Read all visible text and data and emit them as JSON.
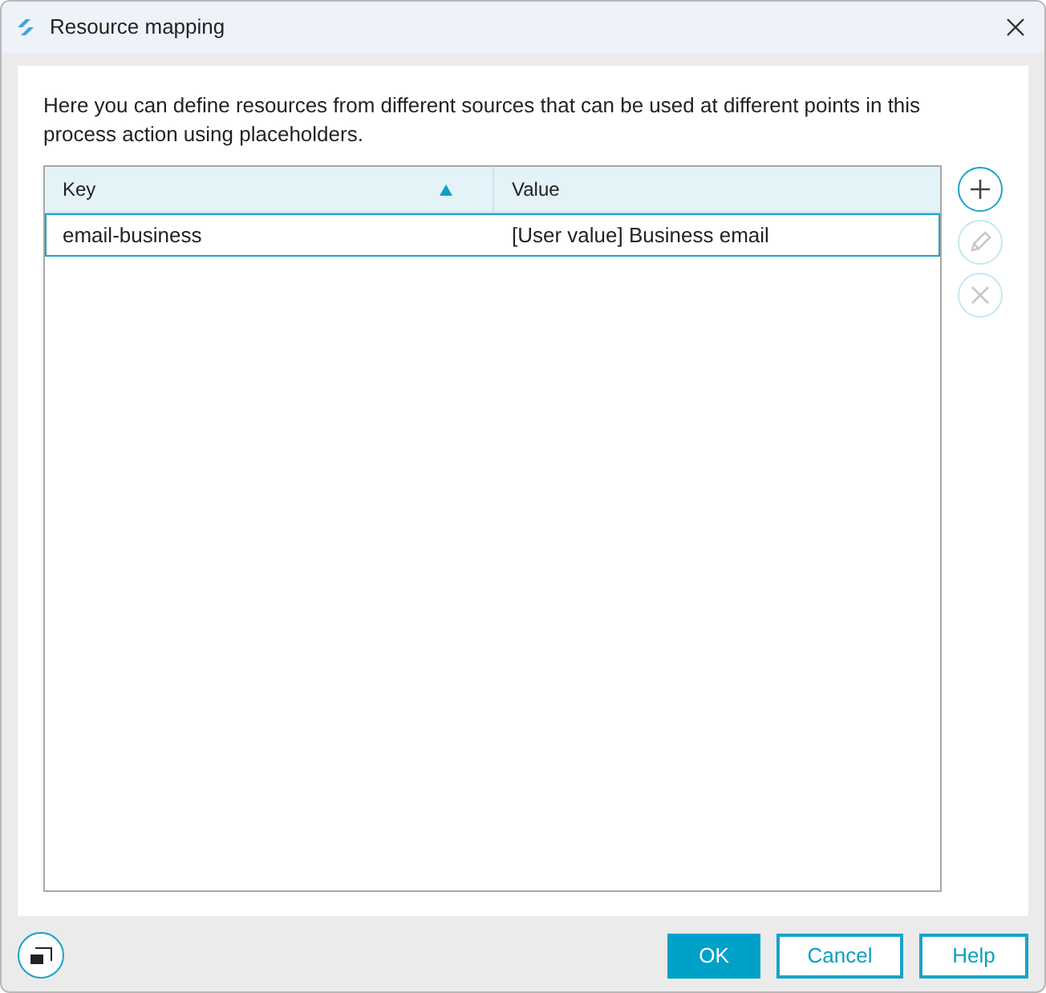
{
  "window": {
    "title": "Resource mapping"
  },
  "description": "Here you can define resources from different sources that can be used at different points in this process action using placeholders.",
  "table": {
    "columns": [
      {
        "label": "Key",
        "sorted": true
      },
      {
        "label": "Value",
        "sorted": false
      }
    ],
    "rows": [
      {
        "cells": [
          "email-business",
          "[User value] Business email"
        ],
        "selected": true
      }
    ]
  },
  "side_buttons": [
    {
      "kind": "add",
      "disabled": false
    },
    {
      "kind": "edit",
      "disabled": true
    },
    {
      "kind": "delete",
      "disabled": true
    }
  ],
  "buttons": [
    {
      "label": "OK",
      "kind": "primary"
    },
    {
      "label": "Cancel",
      "kind": "secondary"
    },
    {
      "label": "Help",
      "kind": "secondary"
    }
  ]
}
